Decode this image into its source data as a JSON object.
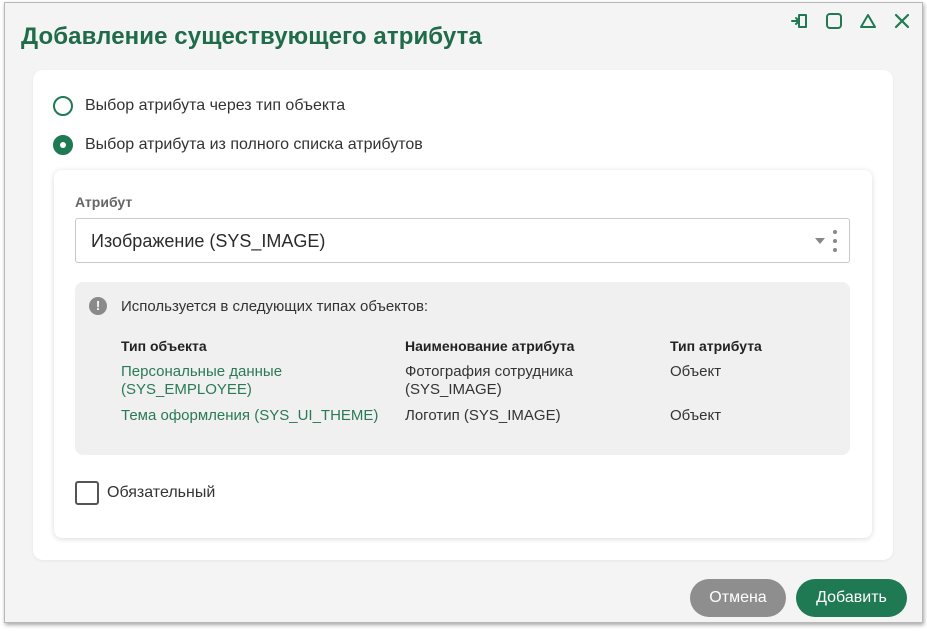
{
  "dialog": {
    "title": "Добавление существующего атрибута",
    "controls": [
      {
        "name": "pin-icon"
      },
      {
        "name": "maximize-icon"
      },
      {
        "name": "collapse-icon"
      },
      {
        "name": "close-icon"
      }
    ]
  },
  "mode": {
    "options": [
      {
        "label": "Выбор атрибута через тип объекта",
        "checked": false
      },
      {
        "label": "Выбор атрибута из полного списка атрибутов",
        "checked": true
      }
    ]
  },
  "attribute": {
    "label": "Атрибут",
    "value": "Изображение (SYS_IMAGE)"
  },
  "usage": {
    "icon": "exclamation-icon",
    "message": "Используется в следующих типах объектов:",
    "columns": [
      "Тип объекта",
      "Наименование атрибута",
      "Тип атрибута"
    ],
    "rows": [
      {
        "object_type": "Персональные данные (SYS_EMPLOYEE)",
        "attribute_name": "Фотография сотрудника (SYS_IMAGE)",
        "attribute_type": "Объект"
      },
      {
        "object_type": "Тема оформления (SYS_UI_THEME)",
        "attribute_name": "Логотип (SYS_IMAGE)",
        "attribute_type": "Объект"
      }
    ]
  },
  "required": {
    "label": "Обязательный",
    "checked": false
  },
  "buttons": {
    "cancel": "Отмена",
    "add": "Добавить"
  },
  "colors": {
    "accent": "#1f7a53",
    "title": "#1f6b4a",
    "cancel": "#8e8e8e"
  }
}
